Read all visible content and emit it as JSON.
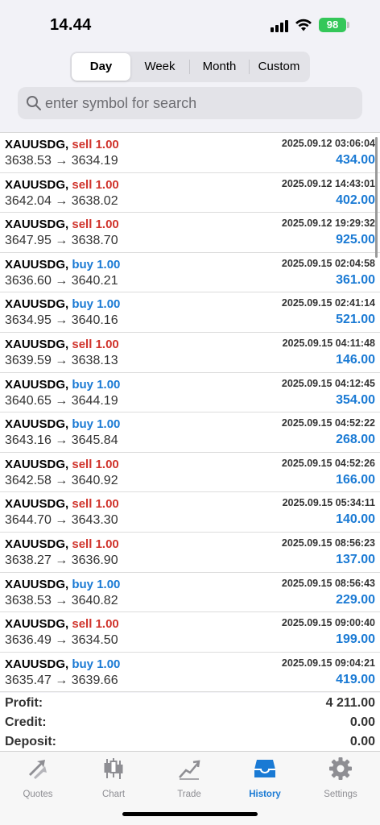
{
  "status": {
    "time": "14.44",
    "battery": "98"
  },
  "periods": {
    "day": "Day",
    "week": "Week",
    "month": "Month",
    "custom": "Custom",
    "selected": "Day"
  },
  "search": {
    "placeholder": "enter symbol for search"
  },
  "trades": [
    {
      "symbol": "XAUUSDG,",
      "side": "sell",
      "volume": "1.00",
      "open": "3638.53",
      "close": "3634.19",
      "time": "2025.09.12 03:06:04",
      "profit": "434.00"
    },
    {
      "symbol": "XAUUSDG,",
      "side": "sell",
      "volume": "1.00",
      "open": "3642.04",
      "close": "3638.02",
      "time": "2025.09.12 14:43:01",
      "profit": "402.00"
    },
    {
      "symbol": "XAUUSDG,",
      "side": "sell",
      "volume": "1.00",
      "open": "3647.95",
      "close": "3638.70",
      "time": "2025.09.12 19:29:32",
      "profit": "925.00"
    },
    {
      "symbol": "XAUUSDG,",
      "side": "buy",
      "volume": "1.00",
      "open": "3636.60",
      "close": "3640.21",
      "time": "2025.09.15 02:04:58",
      "profit": "361.00"
    },
    {
      "symbol": "XAUUSDG,",
      "side": "buy",
      "volume": "1.00",
      "open": "3634.95",
      "close": "3640.16",
      "time": "2025.09.15 02:41:14",
      "profit": "521.00"
    },
    {
      "symbol": "XAUUSDG,",
      "side": "sell",
      "volume": "1.00",
      "open": "3639.59",
      "close": "3638.13",
      "time": "2025.09.15 04:11:48",
      "profit": "146.00"
    },
    {
      "symbol": "XAUUSDG,",
      "side": "buy",
      "volume": "1.00",
      "open": "3640.65",
      "close": "3644.19",
      "time": "2025.09.15 04:12:45",
      "profit": "354.00"
    },
    {
      "symbol": "XAUUSDG,",
      "side": "buy",
      "volume": "1.00",
      "open": "3643.16",
      "close": "3645.84",
      "time": "2025.09.15 04:52:22",
      "profit": "268.00"
    },
    {
      "symbol": "XAUUSDG,",
      "side": "sell",
      "volume": "1.00",
      "open": "3642.58",
      "close": "3640.92",
      "time": "2025.09.15 04:52:26",
      "profit": "166.00"
    },
    {
      "symbol": "XAUUSDG,",
      "side": "sell",
      "volume": "1.00",
      "open": "3644.70",
      "close": "3643.30",
      "time": "2025.09.15 05:34:11",
      "profit": "140.00"
    },
    {
      "symbol": "XAUUSDG,",
      "side": "sell",
      "volume": "1.00",
      "open": "3638.27",
      "close": "3636.90",
      "time": "2025.09.15 08:56:23",
      "profit": "137.00"
    },
    {
      "symbol": "XAUUSDG,",
      "side": "buy",
      "volume": "1.00",
      "open": "3638.53",
      "close": "3640.82",
      "time": "2025.09.15 08:56:43",
      "profit": "229.00"
    },
    {
      "symbol": "XAUUSDG,",
      "side": "sell",
      "volume": "1.00",
      "open": "3636.49",
      "close": "3634.50",
      "time": "2025.09.15 09:00:40",
      "profit": "199.00"
    },
    {
      "symbol": "XAUUSDG,",
      "side": "buy",
      "volume": "1.00",
      "open": "3635.47",
      "close": "3639.66",
      "time": "2025.09.15 09:04:21",
      "profit": "419.00"
    }
  ],
  "summary": {
    "profit_label": "Profit:",
    "profit_value": "4 211.00",
    "credit_label": "Credit:",
    "credit_value": "0.00",
    "deposit_label": "Deposit:",
    "deposit_value": "0.00"
  },
  "tabs": {
    "quotes": "Quotes",
    "chart": "Chart",
    "trade": "Trade",
    "history": "History",
    "settings": "Settings",
    "active": "History"
  },
  "colors": {
    "sell": "#d0342c",
    "buy": "#1a7ad4",
    "accent": "#1a7ad4",
    "battery": "#34c759"
  }
}
